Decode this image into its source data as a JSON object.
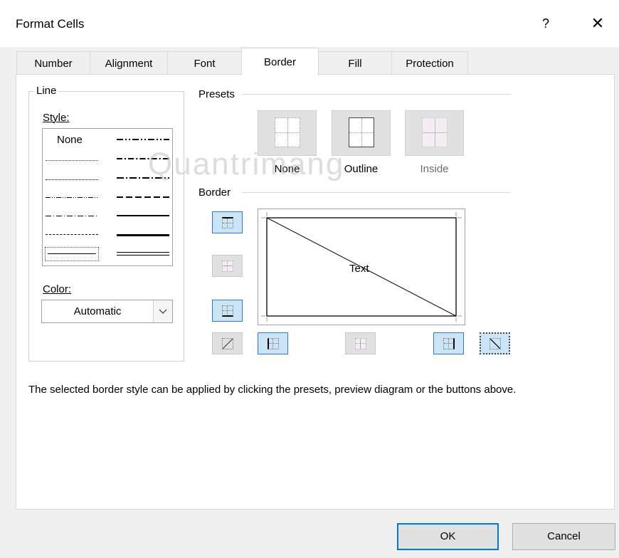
{
  "window": {
    "title": "Format Cells",
    "help": "?",
    "close": "✕"
  },
  "tabs": [
    {
      "label": "Number"
    },
    {
      "label": "Alignment"
    },
    {
      "label": "Font"
    },
    {
      "label": "Border",
      "active": true
    },
    {
      "label": "Fill"
    },
    {
      "label": "Protection"
    }
  ],
  "line": {
    "group_label": "Line",
    "style_label": "Style:",
    "style_none": "None",
    "styles": [
      "none",
      "hair",
      "dash-dot-dot",
      "dotted",
      "medium-dash-dot-dot",
      "dash-dot",
      "slant-dash-dot",
      "dash-dot",
      "medium-dash-dot",
      "dash",
      "medium-dashed",
      "thin",
      "medium",
      "double",
      "thick"
    ],
    "selected_style": "thin",
    "color_label": "Color:",
    "color_value": "Automatic"
  },
  "presets": {
    "group_label": "Presets",
    "items": [
      {
        "label": "None",
        "enabled": true
      },
      {
        "label": "Outline",
        "enabled": true
      },
      {
        "label": "Inside",
        "enabled": false
      }
    ]
  },
  "border": {
    "group_label": "Border",
    "preview_text": "Text",
    "buttons_left": [
      {
        "name": "top-border",
        "pressed": true
      },
      {
        "name": "inside-horizontal-border",
        "pressed": false
      },
      {
        "name": "bottom-border",
        "pressed": true
      }
    ],
    "buttons_bottom": [
      {
        "name": "diagonal-up-border",
        "pressed": false
      },
      {
        "name": "left-border",
        "pressed": true
      },
      {
        "name": "inside-vertical-border",
        "pressed": false
      },
      {
        "name": "right-border",
        "pressed": true
      },
      {
        "name": "diagonal-down-border",
        "pressed": true
      }
    ]
  },
  "description": "The selected border style can be applied by clicking the presets, preview diagram or the buttons above.",
  "footer": {
    "ok": "OK",
    "cancel": "Cancel"
  },
  "watermark": "Quantrimang",
  "colors": {
    "accent": "#0078d7",
    "pressed_bg": "#cce4f7",
    "button_bg": "#e1e1e1",
    "dialog_bg": "#f0f0f0"
  }
}
